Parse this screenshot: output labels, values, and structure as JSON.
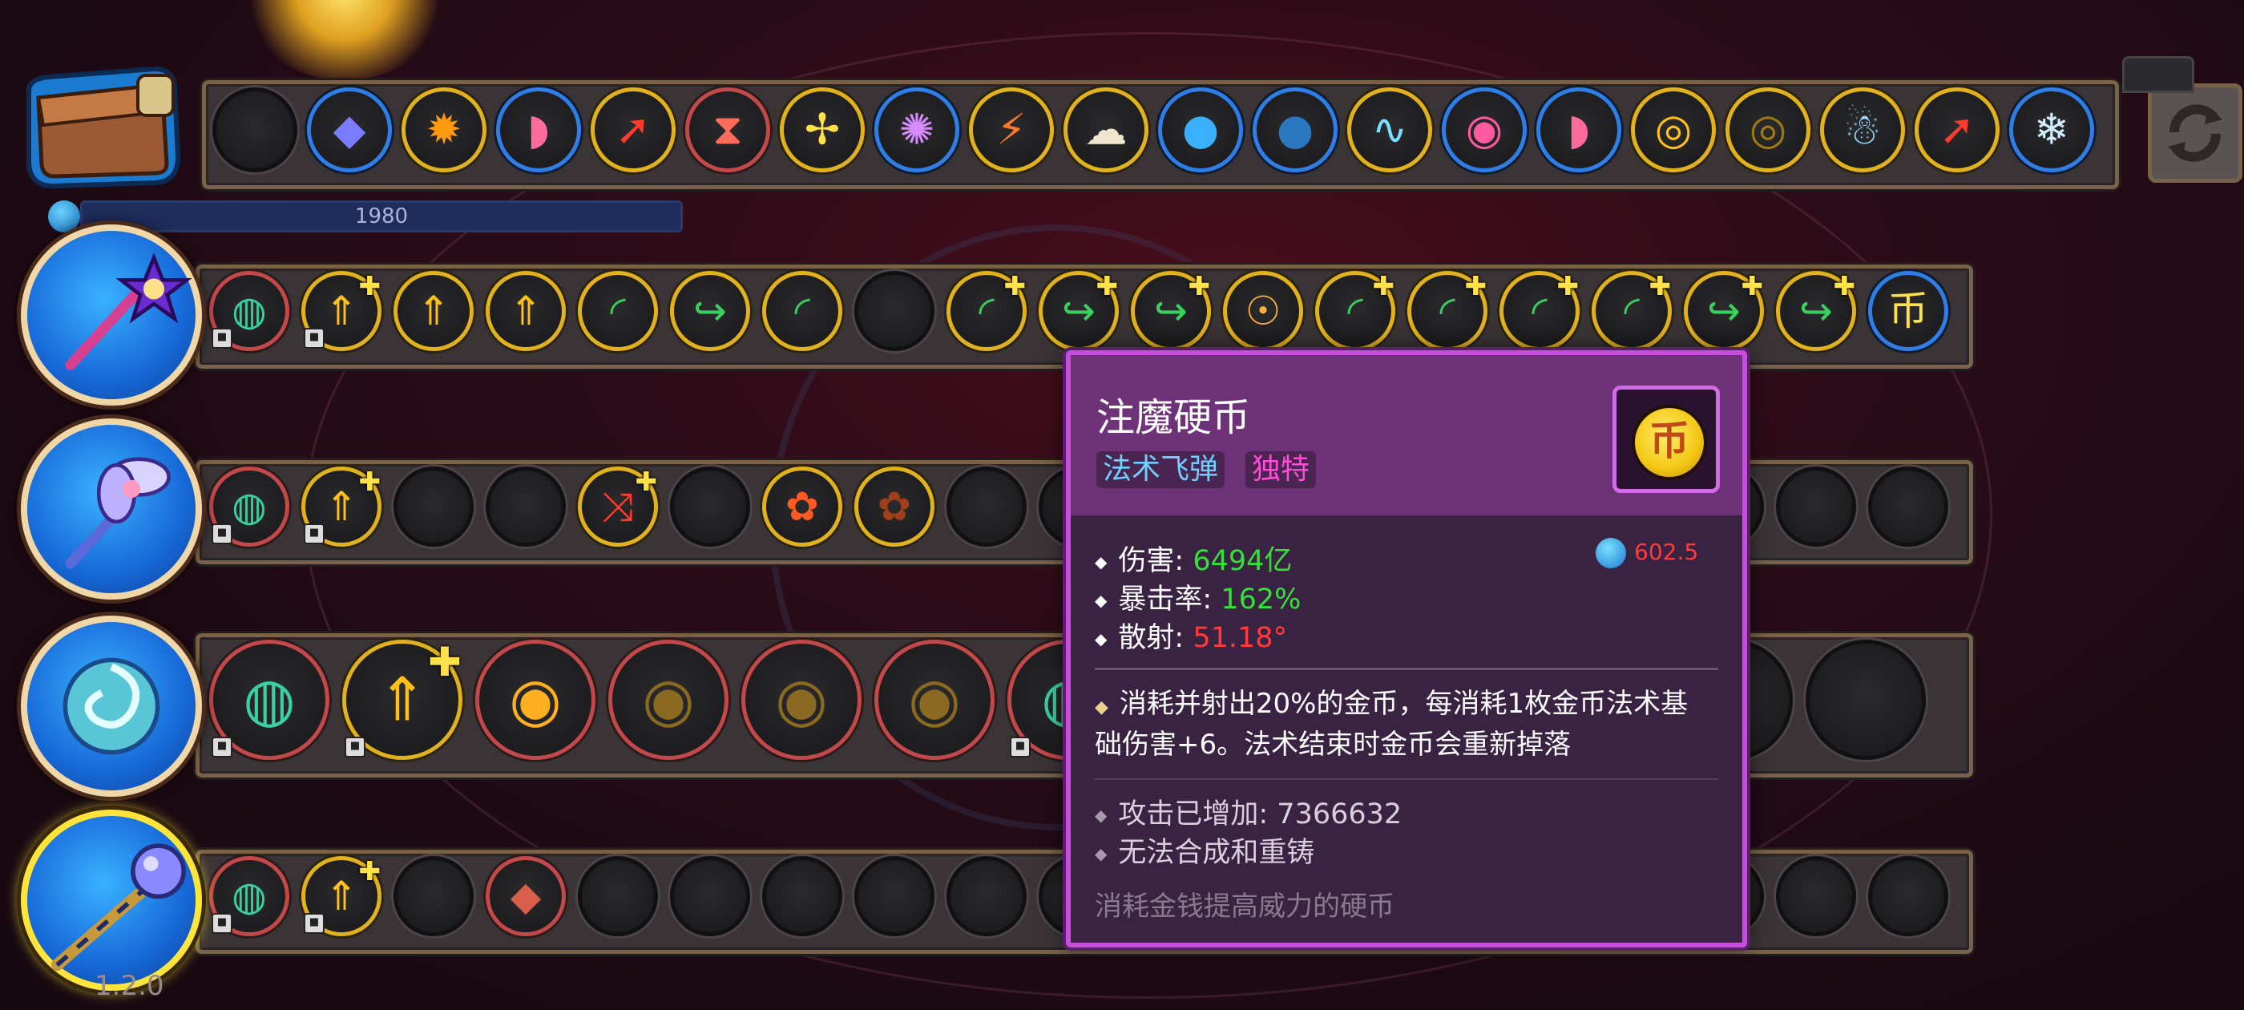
{
  "hud": {
    "mana_value": "1980",
    "version": "1.2.0"
  },
  "colors": {
    "frame": "#7a6248",
    "tooltip_border": "#c64fd9",
    "tooltip_header": "#6e3279",
    "value_green": "#35e03a",
    "value_red": "#ff3b3b",
    "slot_red": "#c2484a",
    "slot_yellow": "#e2b21e",
    "slot_blue": "#2f7ee8"
  },
  "inventory_bar": {
    "icons": [
      "empty-slot",
      "crystal-gem-icon",
      "sun-orb-icon",
      "rainbow-arc-icon",
      "red-slash-icon",
      "hourglass-icon",
      "yellow-cross-frame-icon",
      "purple-vortex-icon",
      "flame-claws-icon",
      "maggot-icon",
      "blue-orb-icon",
      "dark-blue-orb-icon",
      "squiggle-worms-icon",
      "demon-eye-icon",
      "rainbow-arc-icon",
      "golden-ring-icon",
      "dark-golden-ring-icon",
      "blue-ghost-icon",
      "red-slash-icon",
      "ice-bolt-icon"
    ]
  },
  "wand_rows": [
    {
      "name": "purple-star-staff",
      "slots": [
        "jade-coin",
        "gold-arrow-up-plus",
        "gold-arrow-up",
        "gold-arrow-up",
        "green-crescent",
        "green-crescent-arrow",
        "green-crescent",
        "empty",
        "green-crescent-plus",
        "green-crescent-arrow-plus",
        "green-crescent-arrow-plus",
        "golden-eye-rune",
        "green-crescent-plus",
        "green-crescent-plus",
        "green-crescent-plus",
        "green-crescent-plus",
        "green-crescent-arrow-plus",
        "green-crescent-arrow-plus",
        "gold-coin"
      ]
    },
    {
      "name": "flower-staff",
      "slots": [
        "jade-coin",
        "gold-arrow-up-plus",
        "empty",
        "empty",
        "red-triple-arrow-plus",
        "empty",
        "fire-blossom",
        "fire-blossom-dim",
        "empty",
        "empty",
        "empty",
        "empty",
        "empty",
        "empty",
        "empty",
        "empty",
        "empty",
        "empty",
        "empty"
      ]
    },
    {
      "name": "spiral-orb",
      "slots": [
        "jade-coin",
        "gold-arrow-up-plus",
        "radio-wave",
        "radio-wave-dim",
        "radio-wave-dim",
        "radio-wave-dim",
        "jade-coin",
        "empty",
        "empty",
        "empty",
        "empty",
        "empty",
        "empty"
      ]
    },
    {
      "name": "blue-orb-staff",
      "slots": [
        "jade-coin",
        "gold-arrow-up-plus",
        "empty",
        "red-crystal",
        "empty",
        "empty",
        "empty",
        "empty",
        "empty",
        "empty",
        "empty",
        "empty",
        "empty",
        "empty",
        "empty",
        "empty",
        "empty",
        "empty",
        "empty"
      ]
    }
  ],
  "tooltip": {
    "title": "注魔硬币",
    "tag_type": "法术飞弹",
    "tag_unique": "独特",
    "icon": "gold-coin-icon",
    "icon_glyph": "币",
    "mana_cost": "602.5",
    "stats": [
      {
        "label": "伤害: ",
        "value": "6494亿",
        "color": "#35e03a"
      },
      {
        "label": "暴击率: ",
        "value": "162%",
        "color": "#35e03a"
      },
      {
        "label": "散射: ",
        "value": "51.18°",
        "color": "#ff3b3b"
      }
    ],
    "description": "消耗并射出20%的金币，每消耗1枚金币法术基础伤害+6。法术结束时金币会重新掉落",
    "attack_added": "攻击已增加: 7366632",
    "no_combine": "无法合成和重铸",
    "flavor": "消耗金钱提高威力的硬币"
  }
}
